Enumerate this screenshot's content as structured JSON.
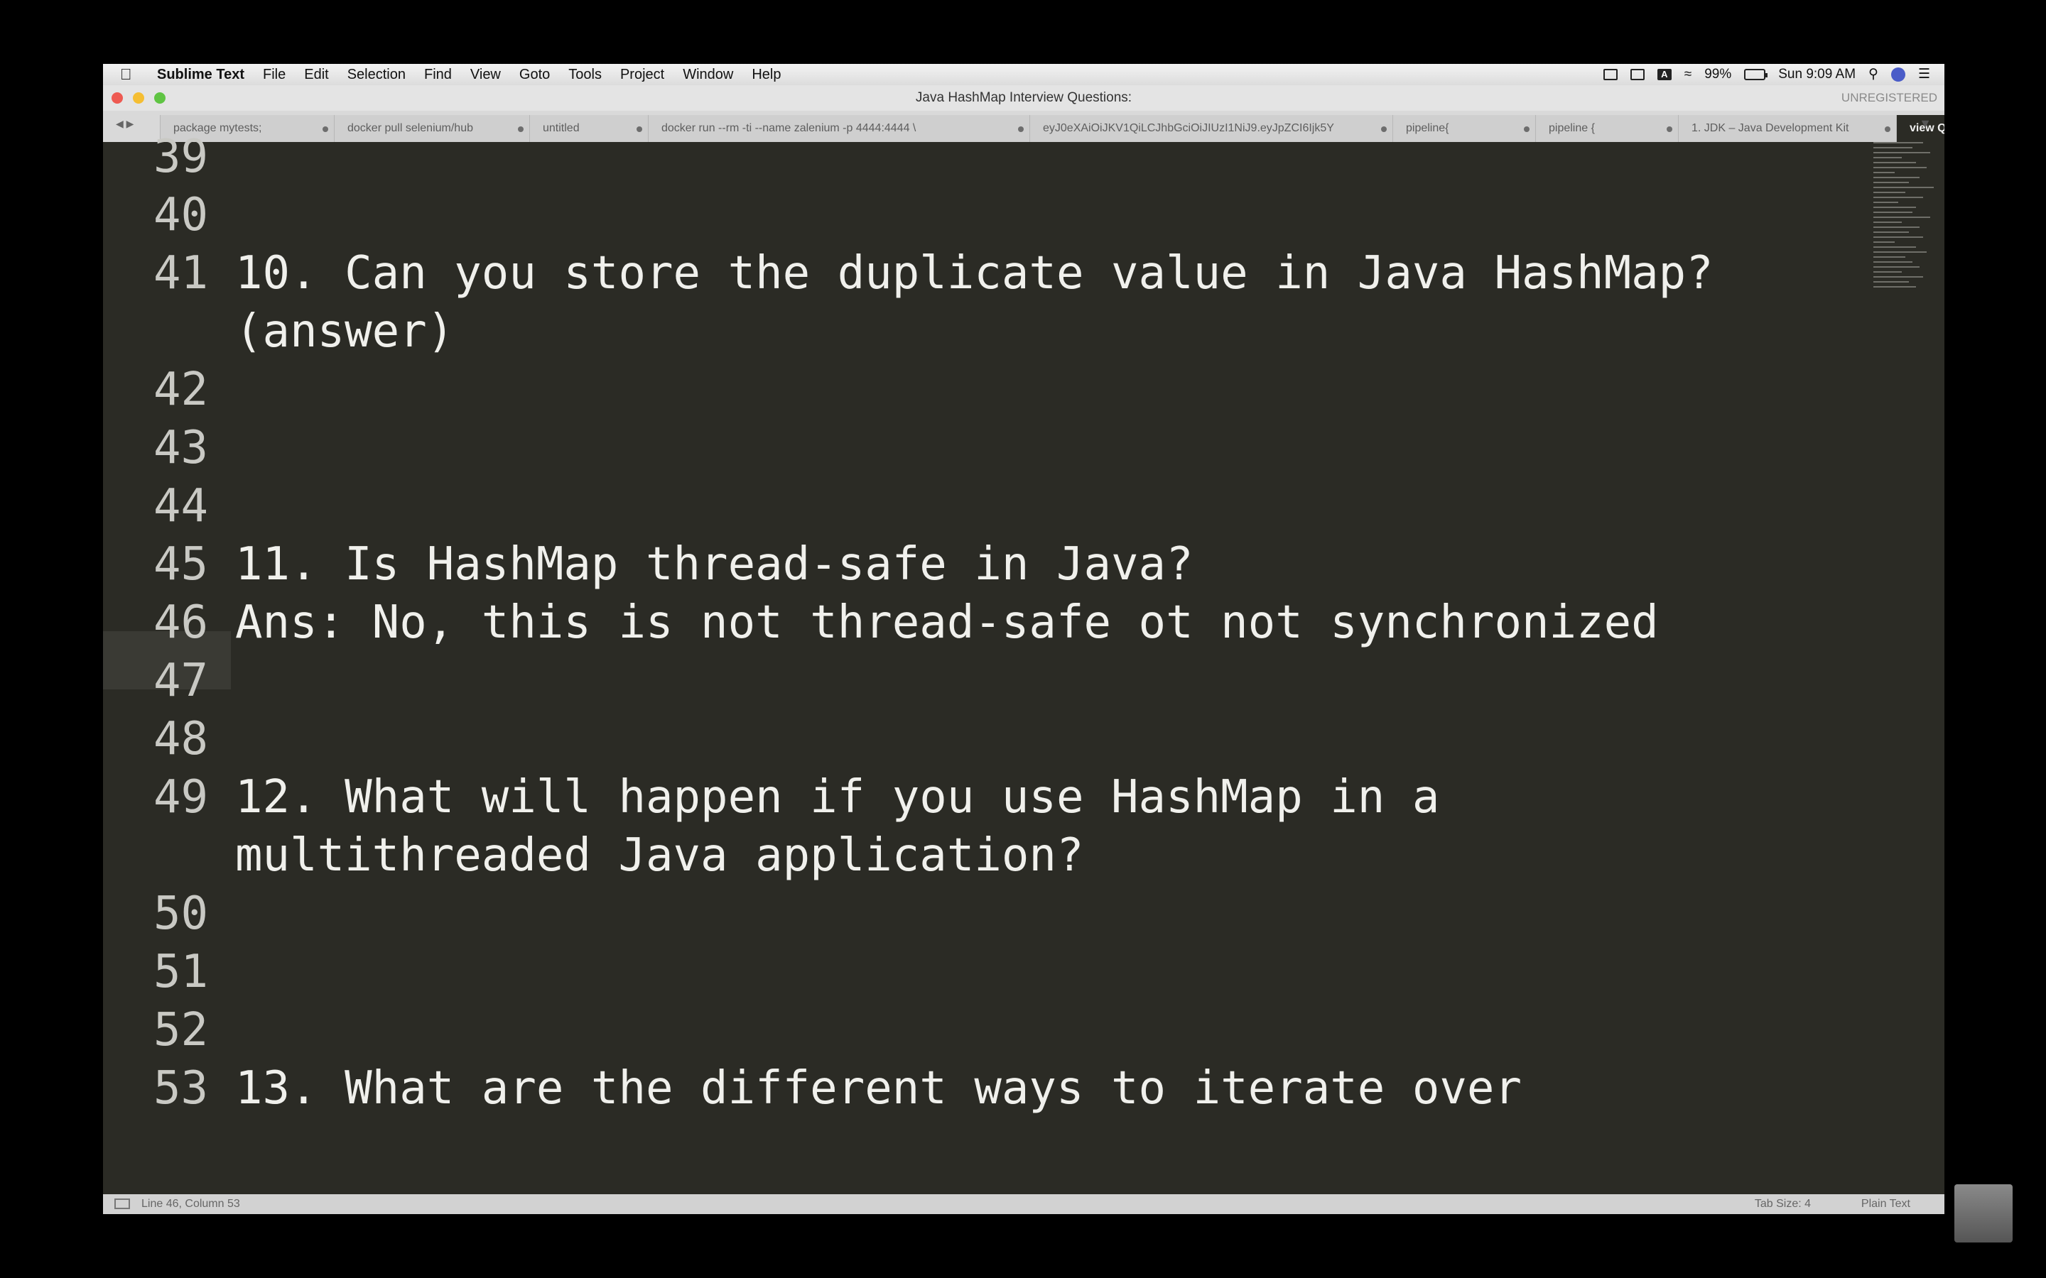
{
  "menubar": {
    "app_name": "Sublime Text",
    "menus": [
      "File",
      "Edit",
      "Selection",
      "Find",
      "View",
      "Goto",
      "Tools",
      "Project",
      "Window",
      "Help"
    ],
    "battery": "99%",
    "clock": "Sun 9:09 AM",
    "keyboard_input": "A"
  },
  "window": {
    "title": "Java HashMap Interview Questions:",
    "license_status": "UNREGISTERED"
  },
  "tabs": [
    {
      "label": "package mytests;",
      "active": false
    },
    {
      "label": "docker pull selenium/hub",
      "active": false
    },
    {
      "label": "untitled",
      "active": false
    },
    {
      "label": "docker run --rm -ti --name zalenium -p 4444:4444 \\",
      "active": false
    },
    {
      "label": "eyJ0eXAiOiJKV1QiLCJhbGciOiJIUzI1NiJ9.eyJpZCI6Ijk5Y",
      "active": false
    },
    {
      "label": "pipeline{",
      "active": false
    },
    {
      "label": "pipeline {",
      "active": false
    },
    {
      "label": "1. JDK – Java Development Kit",
      "active": false
    },
    {
      "label": "view Questions:",
      "active": true
    }
  ],
  "editor": {
    "lines": [
      {
        "no": "39",
        "text": ""
      },
      {
        "no": "40",
        "text": ""
      },
      {
        "no": "41",
        "text": "10. Can you store the duplicate value in Java HashMap?"
      },
      {
        "no": "",
        "text": "(answer)"
      },
      {
        "no": "42",
        "text": ""
      },
      {
        "no": "43",
        "text": ""
      },
      {
        "no": "44",
        "text": ""
      },
      {
        "no": "45",
        "text": "11. Is HashMap thread-safe in Java?"
      },
      {
        "no": "46",
        "text": "Ans: No, this is not thread-safe ot not synchronized"
      },
      {
        "no": "47",
        "text": ""
      },
      {
        "no": "48",
        "text": ""
      },
      {
        "no": "49",
        "text": "12. What will happen if you use HashMap in a"
      },
      {
        "no": "",
        "text": "multithreaded Java application?"
      },
      {
        "no": "50",
        "text": ""
      },
      {
        "no": "51",
        "text": ""
      },
      {
        "no": "52",
        "text": ""
      },
      {
        "no": "53",
        "text": "13. What are the different ways to iterate over"
      }
    ]
  },
  "statusbar": {
    "position": "Line 46, Column 53",
    "tab_size": "Tab Size: 4",
    "syntax": "Plain Text"
  },
  "dock": {
    "apps": [
      {
        "name": "finder-icon",
        "color": "#f5e9c9"
      },
      {
        "name": "finder-face-icon",
        "color": "#3d8ee8"
      },
      {
        "name": "launchpad-icon",
        "color": "#9aa3ad"
      },
      {
        "name": "safari-icon",
        "color": "#2f8ff0"
      },
      {
        "name": "preview-icon",
        "color": "#6f8fb2"
      },
      {
        "name": "facetime-icon",
        "color": "#2fb24a"
      },
      {
        "name": "messages-icon",
        "color": "#3aa0f5"
      },
      {
        "name": "maps-icon",
        "color": "#5ab55a"
      },
      {
        "name": "photos-icon",
        "color": "#f0a030"
      },
      {
        "name": "notebook-icon",
        "color": "#b08050"
      },
      {
        "name": "calendar-icon",
        "color": "#f5f5f5"
      },
      {
        "name": "reminders-icon",
        "color": "#f5f5f5"
      },
      {
        "name": "notes-icon",
        "color": "#f7e08a"
      },
      {
        "name": "music-icon",
        "color": "#f54a6a"
      },
      {
        "name": "podcasts-icon",
        "color": "#a855d8"
      },
      {
        "name": "apple-tv-icon",
        "color": "#111111"
      },
      {
        "name": "numbers-icon",
        "color": "#3bb54a"
      },
      {
        "name": "keynote-icon",
        "color": "#3a7be0"
      },
      {
        "name": "pages-icon",
        "color": "#f59a2a"
      },
      {
        "name": "app-store-icon",
        "color": "#2f8ff0"
      },
      {
        "name": "system-preferences-icon",
        "color": "#8a8a8a"
      },
      {
        "name": "chrome-icon",
        "color": "#e8453c"
      },
      {
        "name": "excel-icon",
        "color": "#1e7145"
      },
      {
        "name": "eclipse-icon",
        "color": "#2c2255"
      },
      {
        "name": "xcode-icon",
        "color": "#3a86d8"
      },
      {
        "name": "cucumber-icon",
        "color": "#3bb54a"
      },
      {
        "name": "sublime-text-icon",
        "color": "#f58a2a"
      },
      {
        "name": "terminal-icon",
        "color": "#1a1a1a"
      },
      {
        "name": "obs-icon",
        "color": "#202020"
      },
      {
        "name": "app-orange-icon",
        "color": "#f5a04a"
      }
    ],
    "docs": [
      {
        "name": "screenshot-1-icon",
        "color": "#3a4a6a"
      },
      {
        "name": "screenshot-2-icon",
        "color": "#d0d6dc"
      },
      {
        "name": "screenshot-3-icon",
        "color": "#3a3a3a"
      },
      {
        "name": "screenshot-4-icon",
        "color": "#c8d8e8"
      },
      {
        "name": "screenshot-5-icon",
        "color": "#e0e0e0"
      },
      {
        "name": "screenshot-6-icon",
        "color": "#d8d8d8"
      },
      {
        "name": "screenshot-7-icon",
        "color": "#e4e4e4"
      },
      {
        "name": "downloads-icon",
        "color": "#5a5a5a"
      },
      {
        "name": "trash-icon",
        "color": "#dfe5ea"
      }
    ]
  }
}
